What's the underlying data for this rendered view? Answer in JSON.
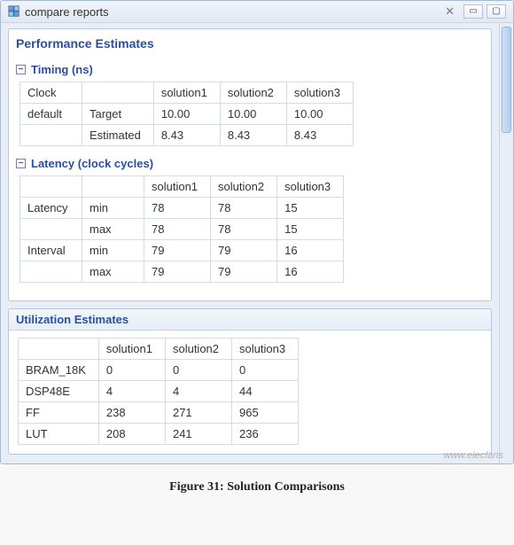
{
  "window": {
    "title": "compare reports",
    "close_glyph": "✕",
    "min_glyph": "▭",
    "max_glyph": "▢"
  },
  "perf": {
    "title": "Performance Estimates",
    "timing": {
      "title": "Timing (ns)",
      "headers": {
        "c0": "Clock",
        "c1": "",
        "c2": "solution1",
        "c3": "solution2",
        "c4": "solution3"
      },
      "rows": [
        {
          "c0": "default",
          "c1": "Target",
          "c2": "10.00",
          "c3": "10.00",
          "c4": "10.00"
        },
        {
          "c0": "",
          "c1": "Estimated",
          "c2": "8.43",
          "c3": "8.43",
          "c4": "8.43"
        }
      ]
    },
    "latency": {
      "title": "Latency (clock cycles)",
      "headers": {
        "c0": "",
        "c1": "",
        "c2": "solution1",
        "c3": "solution2",
        "c4": "solution3"
      },
      "rows": [
        {
          "c0": "Latency",
          "c1": "min",
          "c2": "78",
          "c3": "78",
          "c4": "15"
        },
        {
          "c0": "",
          "c1": "max",
          "c2": "78",
          "c3": "78",
          "c4": "15"
        },
        {
          "c0": "Interval",
          "c1": "min",
          "c2": "79",
          "c3": "79",
          "c4": "16"
        },
        {
          "c0": "",
          "c1": "max",
          "c2": "79",
          "c3": "79",
          "c4": "16"
        }
      ]
    }
  },
  "util": {
    "title": "Utilization Estimates",
    "headers": {
      "c0": "",
      "c1": "solution1",
      "c2": "solution2",
      "c3": "solution3"
    },
    "rows": [
      {
        "c0": "BRAM_18K",
        "c1": "0",
        "c2": "0",
        "c3": "0"
      },
      {
        "c0": "DSP48E",
        "c1": "4",
        "c2": "4",
        "c3": "44"
      },
      {
        "c0": "FF",
        "c1": "238",
        "c2": "271",
        "c3": "965"
      },
      {
        "c0": "LUT",
        "c1": "208",
        "c2": "241",
        "c3": "236"
      }
    ]
  },
  "caption": "Figure 31: Solution Comparisons",
  "expander_glyph": "−",
  "watermark": "www.elecfans"
}
